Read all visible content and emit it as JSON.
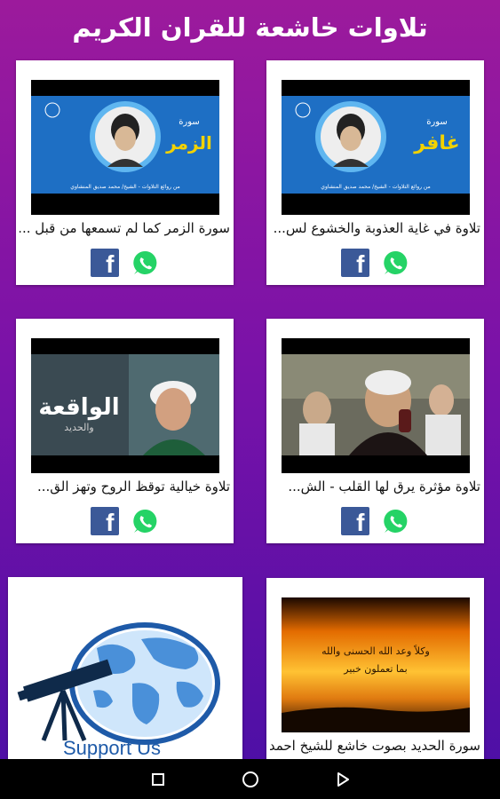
{
  "header": {
    "title": "تلاوات خاشعة للقران الكريم"
  },
  "cards": [
    {
      "thumb_surah": "سورة",
      "thumb_name": "غافر",
      "thumb_footer": "من روائع التلاوات - الشيخ/ محمد صديق المنشاوي",
      "title": "تلاوة في غاية العذوبة والخشوع لس..."
    },
    {
      "thumb_surah": "سورة",
      "thumb_name": "الزمر",
      "thumb_footer": "من روائع التلاوات - الشيخ/ محمد صديق المنشاوي",
      "title": "سورة الزمر كما لم تسمعها من قبل ..."
    },
    {
      "title": "تلاوة مؤثرة يرق لها القلب - الش..."
    },
    {
      "thumb_name": "الواقعة",
      "thumb_sub": "والحديد",
      "title": "تلاوة خيالية توقظ الروح وتهز الق..."
    },
    {
      "thumb_line1": "وكلاً وعد الله الحسنى والله",
      "thumb_line2": "بما تعملون خبير",
      "title": "سورة الحديد بصوت خاشع للشيخ احمد..."
    }
  ],
  "support": {
    "label": "Support Us"
  },
  "share": {
    "facebook_icon": "facebook-icon",
    "whatsapp_icon": "whatsapp-icon",
    "facebook_glyph": "f"
  },
  "colors": {
    "facebook": "#3b5998",
    "whatsapp": "#25d366",
    "thumb_blue": "#1e6fc4"
  }
}
